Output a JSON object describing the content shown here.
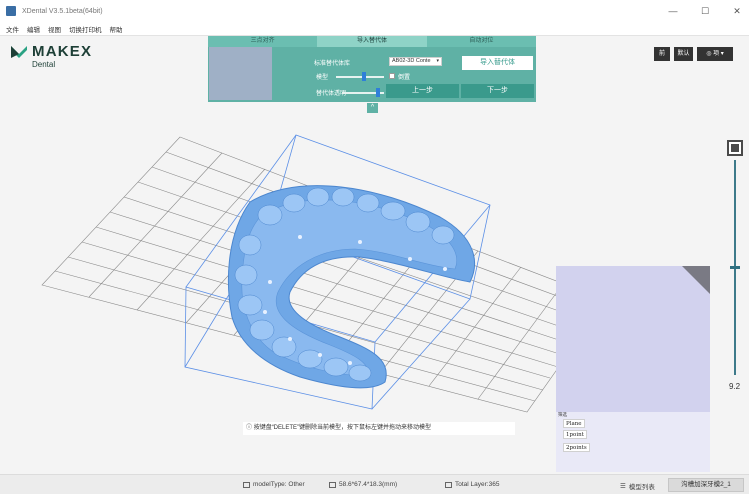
{
  "window": {
    "title": "XDental V3.5.1beta(64bit)",
    "minimize": "—",
    "maximize": "☐",
    "close": "✕"
  },
  "menu": {
    "items": [
      "文件",
      "编辑",
      "视图",
      "切换打印机",
      "帮助"
    ]
  },
  "logo": {
    "brand": "MAKEX",
    "sub": "Dental"
  },
  "wizard": {
    "steps": [
      "三点对齐",
      "导入替代体",
      "自动对位"
    ],
    "active_step": 1,
    "standard_label": "标准替代体库",
    "standard_value": "AB02-3D Conte",
    "import_label": "导入替代体",
    "model_label": "模型",
    "alt_label": "替代体透明",
    "flip_label": "倒置",
    "prev_label": "上一步",
    "next_label": "下一步",
    "collapse_icon": "^",
    "accent": "#5fb1a5"
  },
  "toolbar_right": {
    "btn1": "前",
    "btn2": "默认",
    "eye_label": "◎ 项 ▾"
  },
  "right_slider": {
    "value": "9.2",
    "level": 0.52
  },
  "side_panel": {
    "tag": "筛选",
    "options": [
      "Plane",
      "1point",
      "2points"
    ]
  },
  "hint": {
    "icon": "ⓘ",
    "text": "按键盘“DELETE”键删除当前模型，按下鼠标左键并拖动来移动模型"
  },
  "status": {
    "model_type": "modelType: Other",
    "dims": "58.6*67.4*18.3(mm)",
    "layers": "Total Layer:365",
    "list_label": "模型列表",
    "action_label": "沟槽加深牙模2_1"
  }
}
